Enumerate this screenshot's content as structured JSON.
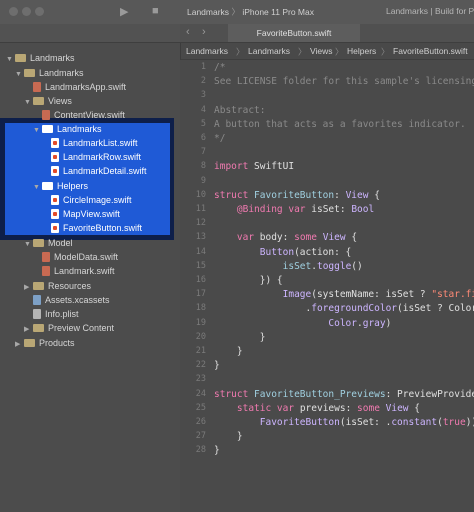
{
  "toolbar": {
    "scheme_target": "Landmarks",
    "scheme_device": "iPhone 11 Pro Max",
    "status": "Landmarks | Build for Previews"
  },
  "editor": {
    "tab_label": "FavoriteButton.swift",
    "breadcrumbs": [
      "Landmarks",
      "Landmarks",
      "Views",
      "Helpers",
      "FavoriteButton.swift"
    ]
  },
  "navigator": {
    "items": [
      {
        "label": "Landmarks",
        "kind": "project",
        "depth": 0,
        "open": true
      },
      {
        "label": "Landmarks",
        "kind": "folder",
        "depth": 1,
        "open": true
      },
      {
        "label": "LandmarksApp.swift",
        "kind": "swift",
        "depth": 2
      },
      {
        "label": "Views",
        "kind": "folder",
        "depth": 2,
        "open": true
      },
      {
        "label": "ContentView.swift",
        "kind": "swift",
        "depth": 3
      },
      {
        "label": "Landmarks",
        "kind": "folder",
        "depth": 3,
        "open": true
      },
      {
        "label": "LandmarkList.swift",
        "kind": "swift",
        "depth": 4
      },
      {
        "label": "LandmarkRow.swift",
        "kind": "swift",
        "depth": 4
      },
      {
        "label": "LandmarkDetail.swift",
        "kind": "swift",
        "depth": 4
      },
      {
        "label": "Helpers",
        "kind": "folder",
        "depth": 3,
        "open": true
      },
      {
        "label": "CircleImage.swift",
        "kind": "swift",
        "depth": 4
      },
      {
        "label": "MapView.swift",
        "kind": "swift",
        "depth": 4
      },
      {
        "label": "FavoriteButton.swift",
        "kind": "swift",
        "depth": 4
      },
      {
        "label": "Model",
        "kind": "folder",
        "depth": 2,
        "open": true
      },
      {
        "label": "ModelData.swift",
        "kind": "swift",
        "depth": 3
      },
      {
        "label": "Landmark.swift",
        "kind": "swift",
        "depth": 3
      },
      {
        "label": "Resources",
        "kind": "folder",
        "depth": 2,
        "open": false
      },
      {
        "label": "Assets.xcassets",
        "kind": "asset",
        "depth": 2
      },
      {
        "label": "Info.plist",
        "kind": "file",
        "depth": 2
      },
      {
        "label": "Preview Content",
        "kind": "folder",
        "depth": 2,
        "open": false
      },
      {
        "label": "Products",
        "kind": "folder",
        "depth": 1,
        "open": false
      }
    ]
  },
  "code": {
    "lines": [
      [
        {
          "t": "/*",
          "c": "comment"
        }
      ],
      [
        {
          "t": "See LICENSE folder for this sample's licensing",
          "c": "comment"
        }
      ],
      [],
      [
        {
          "t": "Abstract:",
          "c": "comment"
        }
      ],
      [
        {
          "t": "A button that acts as a favorites indicator.",
          "c": "comment"
        }
      ],
      [
        {
          "t": "*/",
          "c": "comment"
        }
      ],
      [],
      [
        {
          "t": "import",
          "c": "kw"
        },
        {
          "t": " SwiftUI",
          "c": "id"
        }
      ],
      [],
      [
        {
          "t": "struct",
          "c": "kw"
        },
        {
          "t": " FavoriteButton",
          "c": "type"
        },
        {
          "t": ": ",
          "c": "id"
        },
        {
          "t": "View",
          "c": "fn"
        },
        {
          "t": " {",
          "c": "id"
        }
      ],
      [
        {
          "t": "    @Binding",
          "c": "kw"
        },
        {
          "t": " var",
          "c": "kw"
        },
        {
          "t": " isSet",
          "c": "id"
        },
        {
          "t": ": ",
          "c": "id"
        },
        {
          "t": "Bool",
          "c": "fn"
        }
      ],
      [],
      [
        {
          "t": "    var",
          "c": "kw"
        },
        {
          "t": " body",
          "c": "id"
        },
        {
          "t": ": ",
          "c": "id"
        },
        {
          "t": "some",
          "c": "kw"
        },
        {
          "t": " View",
          "c": "fn"
        },
        {
          "t": " {",
          "c": "id"
        }
      ],
      [
        {
          "t": "        Button",
          "c": "fn"
        },
        {
          "t": "(action: {",
          "c": "id"
        }
      ],
      [
        {
          "t": "            isSet",
          "c": "type"
        },
        {
          "t": ".",
          "c": "id"
        },
        {
          "t": "toggle",
          "c": "fn"
        },
        {
          "t": "()",
          "c": "id"
        }
      ],
      [
        {
          "t": "        }) {",
          "c": "id"
        }
      ],
      [
        {
          "t": "            Image",
          "c": "fn"
        },
        {
          "t": "(systemName: isSet ? ",
          "c": "id"
        },
        {
          "t": "\"star.fi",
          "c": "str"
        }
      ],
      [
        {
          "t": "                .",
          "c": "id"
        },
        {
          "t": "foregroundColor",
          "c": "fn"
        },
        {
          "t": "(isSet ? Color",
          "c": "id"
        }
      ],
      [
        {
          "t": "                    Color",
          "c": "fn"
        },
        {
          "t": ".",
          "c": "id"
        },
        {
          "t": "gray",
          "c": "fn"
        },
        {
          "t": ")",
          "c": "id"
        }
      ],
      [
        {
          "t": "        }",
          "c": "id"
        }
      ],
      [
        {
          "t": "    }",
          "c": "id"
        }
      ],
      [
        {
          "t": "}",
          "c": "id"
        }
      ],
      [],
      [
        {
          "t": "struct",
          "c": "kw"
        },
        {
          "t": " FavoriteButton_Previews",
          "c": "type"
        },
        {
          "t": ": PreviewProvide",
          "c": "id"
        }
      ],
      [
        {
          "t": "    static",
          "c": "kw"
        },
        {
          "t": " var",
          "c": "kw"
        },
        {
          "t": " previews",
          "c": "id"
        },
        {
          "t": ": ",
          "c": "id"
        },
        {
          "t": "some",
          "c": "kw"
        },
        {
          "t": " View",
          "c": "fn"
        },
        {
          "t": " {",
          "c": "id"
        }
      ],
      [
        {
          "t": "        FavoriteButton",
          "c": "fn"
        },
        {
          "t": "(isSet: .",
          "c": "id"
        },
        {
          "t": "constant",
          "c": "fn"
        },
        {
          "t": "(",
          "c": "id"
        },
        {
          "t": "true",
          "c": "kw"
        },
        {
          "t": "))",
          "c": "id"
        }
      ],
      [
        {
          "t": "    }",
          "c": "id"
        }
      ],
      [
        {
          "t": "}",
          "c": "id"
        }
      ]
    ]
  },
  "colors": {
    "selection": "#1f5ad6",
    "selection_border": "#0e1f4a"
  },
  "icons": [
    "close-icon",
    "minimize-icon",
    "zoom-icon",
    "run-icon",
    "stop-icon",
    "folder-icon",
    "swift-file-icon",
    "chevron-right-icon"
  ]
}
